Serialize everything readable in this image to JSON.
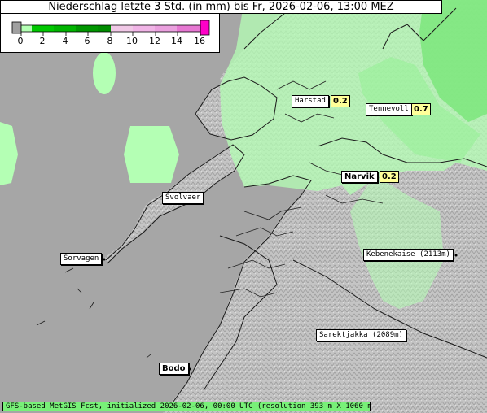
{
  "title": "Niederschlag letzte 3 Std. (in mm) bis Fr, 2026-02-06, 13:00 MEZ",
  "legend": {
    "ticks": [
      "0",
      "2",
      "4",
      "6",
      "8",
      "10",
      "12",
      "14",
      "16"
    ],
    "colors": [
      "#a0a0a0",
      "#b4ffb4",
      "#00c800",
      "#00b400",
      "#008c00",
      "#f0c8e6",
      "#f0b4e6",
      "#e678d2",
      "#ff00c8"
    ]
  },
  "places": {
    "harstad": "Harstad",
    "tennevoll": "Tennevoll",
    "narvik": "Narvik",
    "svolvaer": "Svolvaer",
    "sorvagen": "Sorvagen",
    "kebnekaise": "Kebenekaise (2113m)",
    "sarektjakka": "Sarektjakka (2089m)",
    "bodo": "Bodo"
  },
  "values": {
    "harstad": "0.2",
    "tennevoll": "0.7",
    "narvik": "0.2"
  },
  "footer": "GFS-based MetGIS Fcst, initialized 2026-02-06, 00:00 UTC  (resolution 393 m X 1060 m)",
  "colors": {
    "sea": "#a6a6a6",
    "land": "#c8c8c8",
    "light_precip": "#b4ffb4",
    "medium_precip": "#78e678"
  }
}
